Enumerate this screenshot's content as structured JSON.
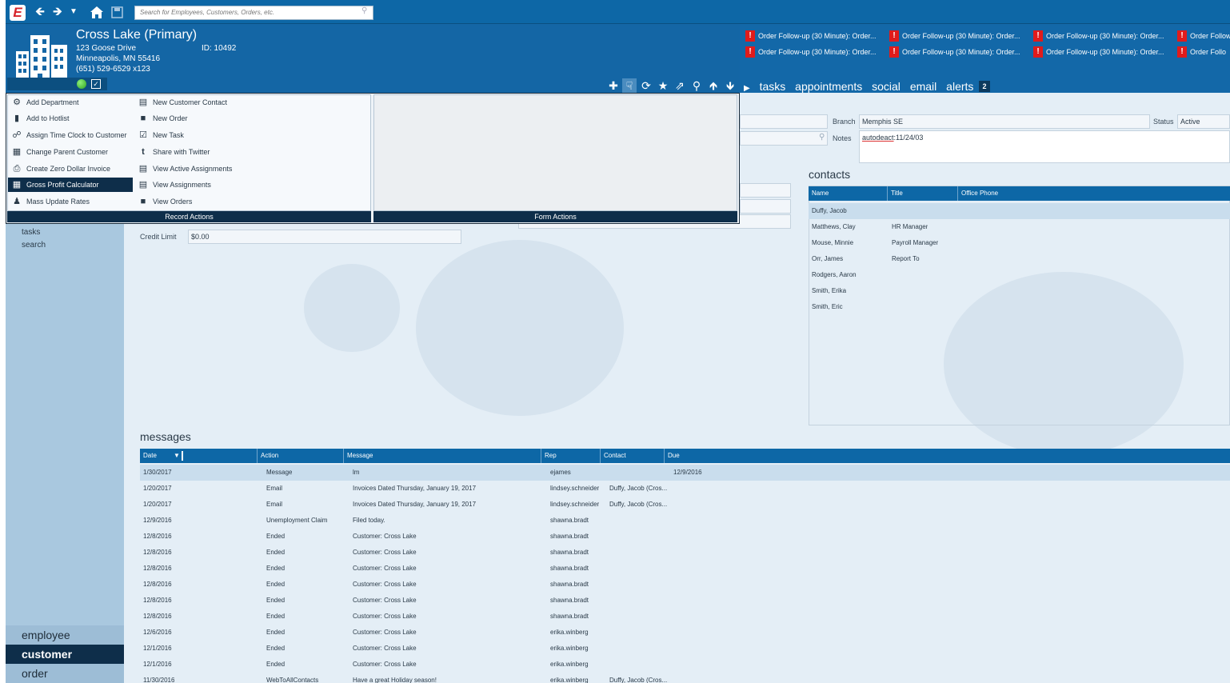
{
  "topbar": {
    "app_logo": "E",
    "search_placeholder": "Search for Employees, Customers, Orders, etc."
  },
  "header": {
    "title": "Cross Lake (Primary)",
    "address1": "123 Goose Drive",
    "address2": "Minneapolis, MN   55416",
    "phone": "(651) 529-6529 x123",
    "id_text": "ID:  10492"
  },
  "alerts": [
    "Order Follow-up (30 Minute): Order...",
    "Order Follow-up (30 Minute): Order...",
    "Order Follow-up (30 Minute): Order...",
    "Order Follow",
    "Order Follow-up (30 Minute): Order...",
    "Order Follow-up (30 Minute): Order...",
    "Order Follow-up (30 Minute): Order...",
    "Order Follo"
  ],
  "navtabs": {
    "tasks": "tasks",
    "appointments": "appointments",
    "social": "social",
    "email": "email",
    "alerts": "alerts",
    "alerts_count": "2"
  },
  "record_actions": {
    "footer": "Record Actions",
    "left": [
      {
        "label": "Add Department",
        "icon": "gear-icon"
      },
      {
        "label": "Add to Hotlist",
        "icon": "bookmark-icon"
      },
      {
        "label": "Assign Time Clock to Customer",
        "icon": "network-icon"
      },
      {
        "label": "Change Parent Customer",
        "icon": "building-icon"
      },
      {
        "label": "Create Zero Dollar Invoice",
        "icon": "invoice-icon"
      },
      {
        "label": "Gross Profit Calculator",
        "icon": "calculator-icon"
      },
      {
        "label": "Mass Update Rates",
        "icon": "people-icon"
      }
    ],
    "right": [
      {
        "label": "New Customer Contact",
        "icon": "contact-card-icon"
      },
      {
        "label": "New Order",
        "icon": "folder-icon"
      },
      {
        "label": "New Task",
        "icon": "checkbox-icon"
      },
      {
        "label": "Share with Twitter",
        "icon": "twitter-icon"
      },
      {
        "label": "View Active Assignments",
        "icon": "document-icon"
      },
      {
        "label": "View Assignments",
        "icon": "document-icon"
      },
      {
        "label": "View Orders",
        "icon": "folder-icon"
      }
    ]
  },
  "form_actions": {
    "footer": "Form Actions"
  },
  "sidebar": {
    "links": [
      "tasks",
      "search"
    ],
    "bottom": [
      {
        "label": "employee",
        "active": false
      },
      {
        "label": "customer",
        "active": true
      },
      {
        "label": "order",
        "active": false
      }
    ]
  },
  "form": {
    "branch_label": "Branch",
    "branch_value": "Memphis SE",
    "status_label": "Status",
    "status_value": "Active",
    "notes_label": "Notes",
    "notes_value_link": "autodeact",
    "notes_value_rest": ":11/24/03",
    "credit_limit_label": "Credit Limit",
    "credit_limit_value": "$0.00"
  },
  "contacts": {
    "title": "contacts",
    "columns": [
      "Name",
      "Title",
      "Office Phone"
    ],
    "rows": [
      {
        "name": "Duffy, Jacob",
        "title": "",
        "phone": ""
      },
      {
        "name": "Matthews, Clay",
        "title": "HR Manager",
        "phone": ""
      },
      {
        "name": "Mouse, Minnie",
        "title": "Payroll Manager",
        "phone": ""
      },
      {
        "name": "Orr, James",
        "title": "Report To",
        "phone": ""
      },
      {
        "name": "Rodgers, Aaron",
        "title": "",
        "phone": ""
      },
      {
        "name": "Smith, Erika",
        "title": "",
        "phone": ""
      },
      {
        "name": "Smith, Eric",
        "title": "",
        "phone": ""
      }
    ]
  },
  "messages": {
    "title": "messages",
    "columns": [
      "Date",
      "Action",
      "Message",
      "Rep",
      "Contact",
      "Due"
    ],
    "rows": [
      [
        "1/30/2017",
        "Message",
        "lm",
        "ejames",
        "",
        "12/9/2016"
      ],
      [
        "1/20/2017",
        "Email",
        "Invoices Dated Thursday, January 19, 2017",
        "lindsey.schneider",
        "Duffy, Jacob (Cros...",
        ""
      ],
      [
        "1/20/2017",
        "Email",
        "Invoices Dated Thursday, January 19, 2017",
        "lindsey.schneider",
        "Duffy, Jacob (Cros...",
        ""
      ],
      [
        "12/9/2016",
        "Unemployment Claim",
        "Filed today.",
        "shawna.bradt",
        "",
        ""
      ],
      [
        "12/8/2016",
        "Ended",
        "Customer: Cross Lake",
        "shawna.bradt",
        "",
        ""
      ],
      [
        "12/8/2016",
        "Ended",
        "Customer: Cross Lake",
        "shawna.bradt",
        "",
        ""
      ],
      [
        "12/8/2016",
        "Ended",
        "Customer: Cross Lake",
        "shawna.bradt",
        "",
        ""
      ],
      [
        "12/8/2016",
        "Ended",
        "Customer: Cross Lake",
        "shawna.bradt",
        "",
        ""
      ],
      [
        "12/8/2016",
        "Ended",
        "Customer: Cross Lake",
        "shawna.bradt",
        "",
        ""
      ],
      [
        "12/8/2016",
        "Ended",
        "Customer: Cross Lake",
        "shawna.bradt",
        "",
        ""
      ],
      [
        "12/6/2016",
        "Ended",
        "Customer: Cross Lake",
        "erika.winberg",
        "",
        ""
      ],
      [
        "12/1/2016",
        "Ended",
        "Customer: Cross Lake",
        "erika.winberg",
        "",
        ""
      ],
      [
        "12/1/2016",
        "Ended",
        "Customer: Cross Lake",
        "erika.winberg",
        "",
        ""
      ],
      [
        "11/30/2016",
        "WebToAllContacts",
        "Have a great Holiday season!",
        "erika.winberg",
        "Duffy, Jacob (Cros...",
        ""
      ]
    ]
  },
  "colors": {
    "brand_blue": "#0d67a6",
    "dark_navy": "#0e2e4a",
    "alert_red": "#e01b1b"
  }
}
